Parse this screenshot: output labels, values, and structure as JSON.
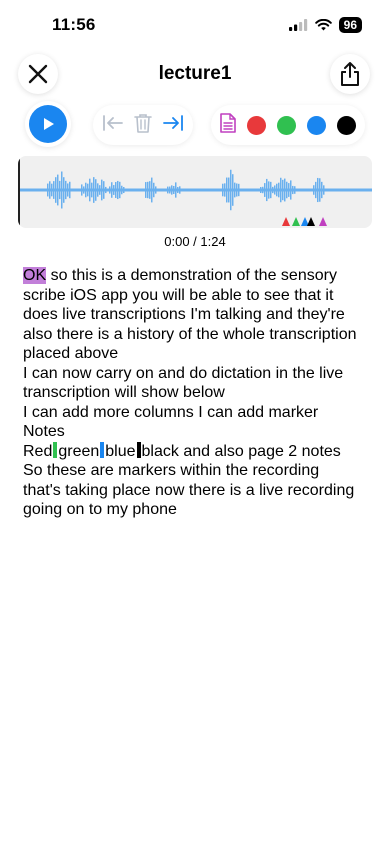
{
  "status_bar": {
    "time": "11:56",
    "battery": "96"
  },
  "header": {
    "title": "lecture1"
  },
  "toolbar": {
    "play_icon": "play-icon",
    "edit_icons": [
      "skip-start-icon",
      "trash-icon",
      "skip-end-icon"
    ],
    "note_icon": "note-icon",
    "marker_colors": [
      "#e8393b",
      "#30c050",
      "#1a86f0",
      "#000000"
    ],
    "accent_color": "#1a86f0"
  },
  "player": {
    "time_display": "0:00 / 1:24"
  },
  "transcript": {
    "lines": [
      [
        "OK",
        " so this is a demonstration of the sensory"
      ],
      "scribe iOS app you will be able to see that it",
      "does live transcriptions I'm talking and they're",
      "also there is a history of the whole transcription",
      "placed above",
      "I can now carry on and do dictation in the live",
      "transcription will show below",
      "I can add more columns I can add marker",
      "Notes",
      [
        "Red",
        "green",
        "blue",
        "black and also page 2 notes"
      ],
      "So these are markers within the recording",
      "that's taking place now there is a live recording",
      "going on to my phone"
    ]
  }
}
